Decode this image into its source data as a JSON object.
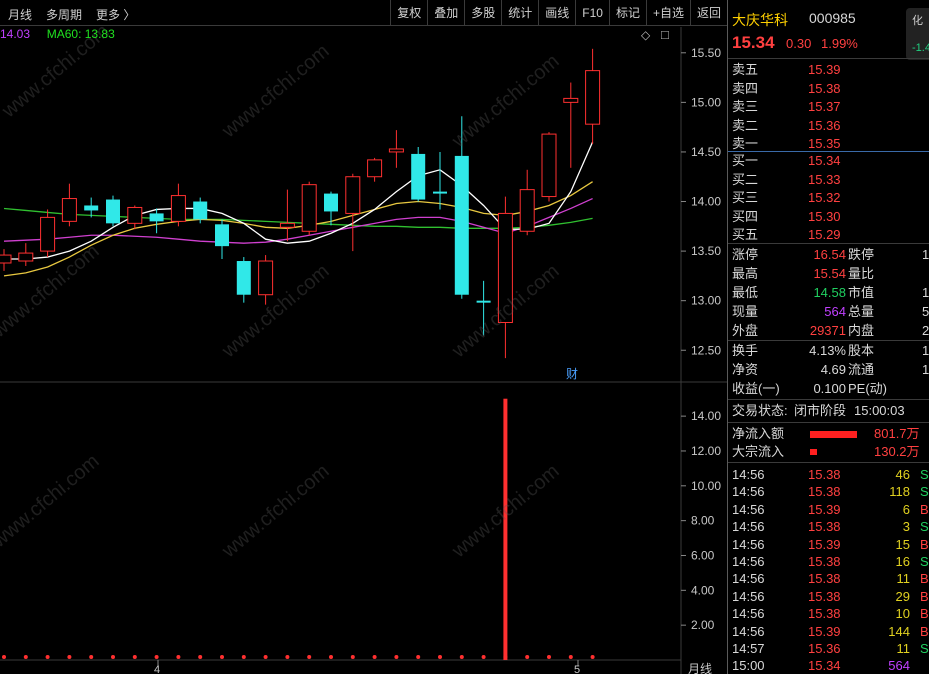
{
  "toolbar": {
    "left": [
      "月线",
      "多周期",
      "更多 〉"
    ],
    "right": [
      "复权",
      "叠加",
      "多股",
      "统计",
      "画线",
      "F10",
      "标记",
      "+自选",
      "返回"
    ]
  },
  "ma_legend": {
    "ma_prefix": "14.03",
    "ma60_label": "MA60: 13.83"
  },
  "glyphs": {
    "diamond": "◇",
    "close": "□"
  },
  "fin_marker": "财",
  "watermark": "www.cfchi.com",
  "bottom": {
    "tick_4": "4",
    "tick_5": "5",
    "period_label": "月线"
  },
  "price_axis": [
    "15.50",
    "15.00",
    "14.50",
    "14.00",
    "13.50",
    "13.00",
    "12.50"
  ],
  "vol_axis": [
    "14.00",
    "12.00",
    "10.00",
    "8.00",
    "6.00",
    "4.00",
    "2.00"
  ],
  "colors": {
    "up": "#ff3030",
    "down": "#30e8e8",
    "ma_white": "#ffffff",
    "ma_yellow": "#e8c840",
    "ma_magenta": "#d040d0",
    "ma_green": "#30c030"
  },
  "quote": {
    "name": "大庆华科",
    "code": "000985",
    "price": "15.34",
    "change": "0.30",
    "change_pct": "1.99%",
    "cut_tab": "化",
    "cut_val": "-1.4",
    "asks": [
      {
        "label": "卖五",
        "price": "15.39"
      },
      {
        "label": "卖四",
        "price": "15.38"
      },
      {
        "label": "卖三",
        "price": "15.37"
      },
      {
        "label": "卖二",
        "price": "15.36"
      },
      {
        "label": "卖一",
        "price": "15.35"
      }
    ],
    "bids": [
      {
        "label": "买一",
        "price": "15.34"
      },
      {
        "label": "买二",
        "price": "15.33"
      },
      {
        "label": "买三",
        "price": "15.32"
      },
      {
        "label": "买四",
        "price": "15.30"
      },
      {
        "label": "买五",
        "price": "15.29"
      }
    ],
    "stats": [
      {
        "l1": "涨停",
        "v1": "16.54",
        "c1": "red",
        "l2": "跌停",
        "v2": "1"
      },
      {
        "l1": "最高",
        "v1": "15.54",
        "c1": "red",
        "l2": "量比",
        "v2": ""
      },
      {
        "l1": "最低",
        "v1": "14.58",
        "c1": "green",
        "l2": "市值",
        "v2": "1"
      },
      {
        "l1": "现量",
        "v1": "564",
        "c1": "purple",
        "l2": "总量",
        "v2": "5"
      },
      {
        "l1": "外盘",
        "v1": "29371",
        "c1": "red",
        "l2": "内盘",
        "v2": "2"
      }
    ],
    "stats2": [
      {
        "l1": "换手",
        "v1": "4.13%",
        "l2": "股本",
        "v2": "1"
      },
      {
        "l1": "净资",
        "v1": "4.69",
        "l2": "流通",
        "v2": "1"
      },
      {
        "l1": "收益(一)",
        "v1": "0.100",
        "l2": "PE(动)",
        "v2": ""
      }
    ],
    "status_label": "交易状态:",
    "status_value": "闭市阶段",
    "status_time": "15:00:03",
    "net_inflow_label": "净流入额",
    "net_inflow_value": "801.7万",
    "net_inflow_bar": 0.85,
    "block_inflow_label": "大宗流入",
    "block_inflow_value": "130.2万",
    "block_inflow_bar": 0.12,
    "ticks": [
      {
        "t": "14:56",
        "p": "15.38",
        "v": "46",
        "s": "S"
      },
      {
        "t": "14:56",
        "p": "15.38",
        "v": "118",
        "s": "S"
      },
      {
        "t": "14:56",
        "p": "15.39",
        "v": "6",
        "s": "B"
      },
      {
        "t": "14:56",
        "p": "15.38",
        "v": "3",
        "s": "S"
      },
      {
        "t": "14:56",
        "p": "15.39",
        "v": "15",
        "s": "B"
      },
      {
        "t": "14:56",
        "p": "15.38",
        "v": "16",
        "s": "S"
      },
      {
        "t": "14:56",
        "p": "15.38",
        "v": "11",
        "s": "B"
      },
      {
        "t": "14:56",
        "p": "15.38",
        "v": "29",
        "s": "B"
      },
      {
        "t": "14:56",
        "p": "15.38",
        "v": "10",
        "s": "B"
      },
      {
        "t": "14:56",
        "p": "15.39",
        "v": "144",
        "s": "B"
      },
      {
        "t": "14:57",
        "p": "15.36",
        "v": "11",
        "s": "S"
      },
      {
        "t": "15:00",
        "p": "15.34",
        "v": "564",
        "s": ""
      }
    ]
  },
  "chart_data": {
    "type": "candlestick",
    "price_ylim": [
      12.2,
      15.75
    ],
    "candles": [
      {
        "o": 13.38,
        "c": 13.46,
        "h": 13.52,
        "l": 13.3
      },
      {
        "o": 13.4,
        "c": 13.48,
        "h": 13.58,
        "l": 13.35
      },
      {
        "o": 13.5,
        "c": 13.84,
        "h": 13.92,
        "l": 13.44
      },
      {
        "o": 13.8,
        "c": 14.03,
        "h": 14.18,
        "l": 13.75
      },
      {
        "o": 13.96,
        "c": 13.91,
        "h": 14.04,
        "l": 13.84
      },
      {
        "o": 14.02,
        "c": 13.78,
        "h": 14.06,
        "l": 13.75
      },
      {
        "o": 13.78,
        "c": 13.94,
        "h": 13.96,
        "l": 13.72
      },
      {
        "o": 13.88,
        "c": 13.8,
        "h": 13.93,
        "l": 13.68
      },
      {
        "o": 13.8,
        "c": 14.06,
        "h": 14.18,
        "l": 13.75
      },
      {
        "o": 14.0,
        "c": 13.82,
        "h": 14.04,
        "l": 13.78
      },
      {
        "o": 13.77,
        "c": 13.55,
        "h": 13.82,
        "l": 13.42
      },
      {
        "o": 13.4,
        "c": 13.06,
        "h": 13.44,
        "l": 12.98
      },
      {
        "o": 13.06,
        "c": 13.4,
        "h": 13.46,
        "l": 12.96
      },
      {
        "o": 13.74,
        "c": 13.78,
        "h": 14.12,
        "l": 13.6
      },
      {
        "o": 13.7,
        "c": 14.17,
        "h": 14.2,
        "l": 13.66
      },
      {
        "o": 14.08,
        "c": 13.9,
        "h": 14.1,
        "l": 13.76
      },
      {
        "o": 13.88,
        "c": 14.25,
        "h": 14.28,
        "l": 13.5
      },
      {
        "o": 14.25,
        "c": 14.42,
        "h": 14.44,
        "l": 14.2
      },
      {
        "o": 14.5,
        "c": 14.53,
        "h": 14.72,
        "l": 14.34
      },
      {
        "o": 14.48,
        "c": 14.02,
        "h": 14.55,
        "l": 14.0
      },
      {
        "o": 14.1,
        "c": 14.08,
        "h": 14.5,
        "l": 13.92
      },
      {
        "o": 14.46,
        "c": 13.06,
        "h": 14.86,
        "l": 13.02
      },
      {
        "o": 13.0,
        "c": 12.98,
        "h": 13.2,
        "l": 12.65
      },
      {
        "o": 12.78,
        "c": 13.88,
        "h": 14.05,
        "l": 12.42
      },
      {
        "o": 13.7,
        "c": 14.12,
        "h": 14.32,
        "l": 13.66
      },
      {
        "o": 14.05,
        "c": 14.68,
        "h": 14.7,
        "l": 14.0
      },
      {
        "o": 15.0,
        "c": 15.04,
        "h": 15.2,
        "l": 14.34
      },
      {
        "o": 14.78,
        "c": 15.32,
        "h": 15.54,
        "l": 14.58
      }
    ],
    "ma_white": [
      13.42,
      13.42,
      13.44,
      13.5,
      13.6,
      13.74,
      13.86,
      13.92,
      13.93,
      13.93,
      13.88,
      13.78,
      13.62,
      13.58,
      13.6,
      13.68,
      13.78,
      13.92,
      14.1,
      14.26,
      14.32,
      14.16,
      13.96,
      13.72,
      13.72,
      13.78,
      14.1,
      14.6
    ],
    "ma_yellow": [
      13.25,
      13.28,
      13.34,
      13.44,
      13.56,
      13.66,
      13.73,
      13.77,
      13.8,
      13.82,
      13.81,
      13.78,
      13.74,
      13.73,
      13.76,
      13.8,
      13.86,
      13.92,
      13.98,
      14.0,
      13.98,
      13.94,
      13.88,
      13.86,
      13.9,
      13.96,
      14.06,
      14.2
    ],
    "ma_magenta": [
      13.6,
      13.61,
      13.62,
      13.64,
      13.66,
      13.66,
      13.65,
      13.64,
      13.62,
      13.6,
      13.59,
      13.58,
      13.59,
      13.62,
      13.66,
      13.7,
      13.74,
      13.78,
      13.82,
      13.84,
      13.84,
      13.8,
      13.74,
      13.68,
      13.75,
      13.84,
      13.93,
      14.03
    ],
    "ma_green": [
      13.93,
      13.91,
      13.89,
      13.87,
      13.86,
      13.85,
      13.84,
      13.83,
      13.82,
      13.82,
      13.82,
      13.81,
      13.8,
      13.79,
      13.78,
      13.77,
      13.76,
      13.75,
      13.75,
      13.74,
      13.74,
      13.73,
      13.73,
      13.73,
      13.74,
      13.76,
      13.79,
      13.83
    ],
    "volume_ylim": [
      0,
      15.5
    ],
    "volume_spike_index": 23,
    "volume_spike_value": 15.0
  }
}
